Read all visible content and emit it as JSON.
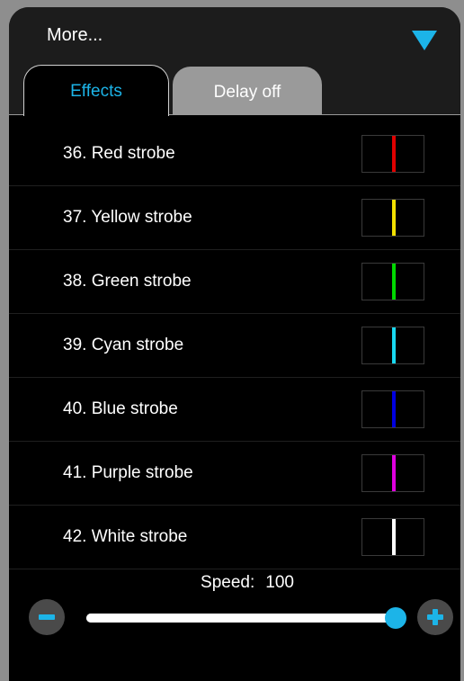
{
  "header": {
    "title": "More...",
    "accent_color": "#1cb4e8"
  },
  "tabs": [
    {
      "label": "Effects",
      "active": true
    },
    {
      "label": "Delay off",
      "active": false
    }
  ],
  "effects": [
    {
      "label": "36. Red strobe",
      "color": "#e00000"
    },
    {
      "label": "37. Yellow strobe",
      "color": "#f2e000"
    },
    {
      "label": "38. Green strobe",
      "color": "#00d800"
    },
    {
      "label": "39. Cyan strobe",
      "color": "#18d8f0"
    },
    {
      "label": "40. Blue strobe",
      "color": "#0000e0"
    },
    {
      "label": "41. Purple strobe",
      "color": "#e000e0"
    },
    {
      "label": "42. White strobe",
      "color": "#ffffff"
    }
  ],
  "speed": {
    "label": "Speed:",
    "value": "100",
    "fraction": 1.0
  }
}
